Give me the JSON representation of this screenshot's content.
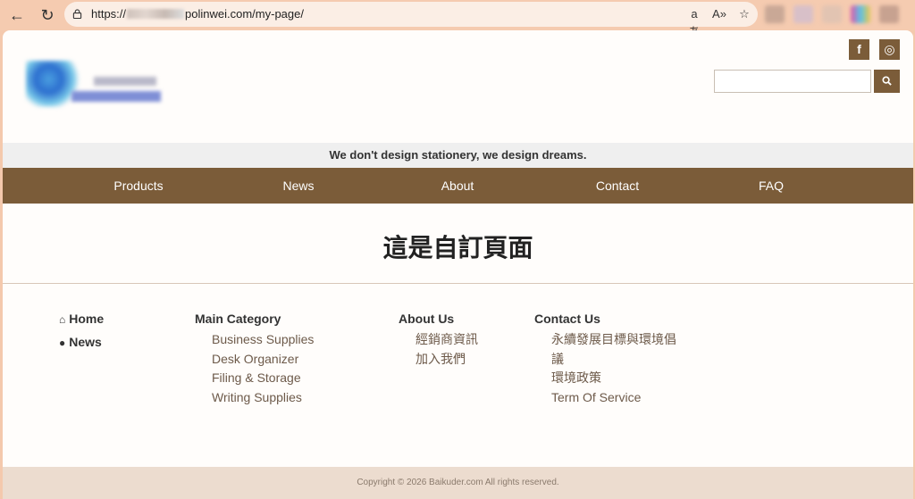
{
  "browser": {
    "url_prefix": "https://",
    "url_suffix": "polinwei.com/my-page/"
  },
  "header": {
    "social_facebook": "f",
    "social_instagram": "◎",
    "search_placeholder": "",
    "search_icon": "magnifier"
  },
  "tagline": "We don't design stationery, we design dreams.",
  "menu": [
    "Products",
    "News",
    "About",
    "Contact",
    "FAQ"
  ],
  "page_title": "這是自訂頁面",
  "footer": {
    "home": "Home",
    "news": "News",
    "main_category": {
      "title": "Main Category",
      "items": [
        "Business Supplies",
        "Desk Organizer",
        "Filing & Storage",
        "Writing Supplies"
      ]
    },
    "about_us": {
      "title": "About Us",
      "items": [
        "經銷商資訊",
        "加入我們"
      ]
    },
    "contact_us": {
      "title": "Contact Us",
      "items": [
        "永續發展目標與環境倡",
        "議",
        "環境政策",
        "Term Of Service"
      ]
    },
    "copyright": "Copyright © 2026 Baikuder.com All rights reserved."
  },
  "colors": {
    "brand_brown": "#7b5c39",
    "chrome_peach": "#f5cbb0"
  }
}
